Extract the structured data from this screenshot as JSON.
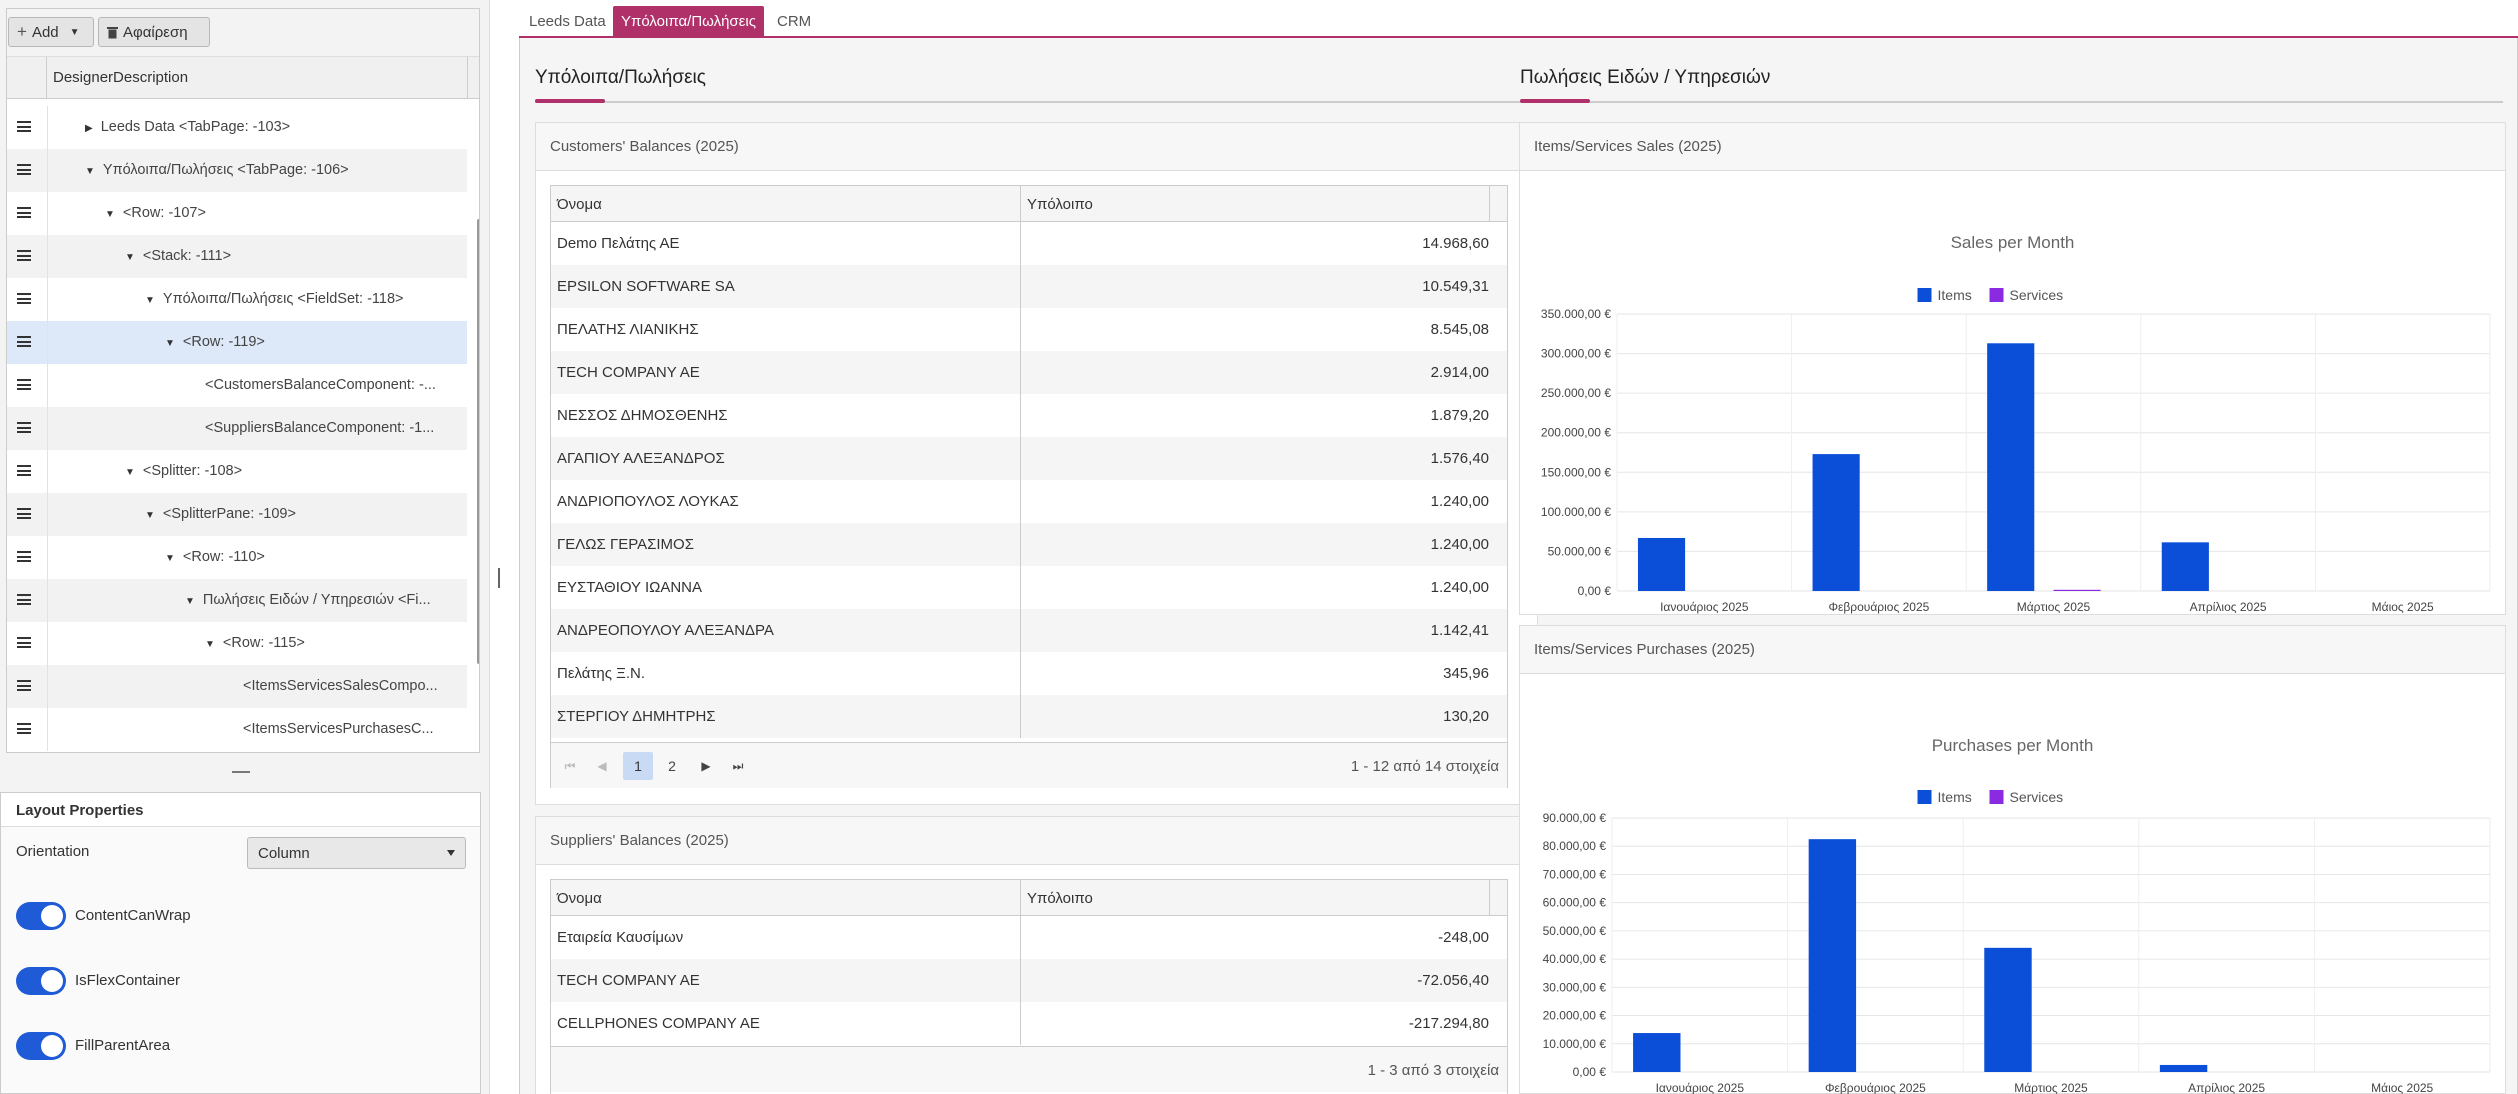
{
  "left_panel": {
    "toolbar": {
      "add_label": "Add",
      "remove_label": "Αφαίρεση"
    },
    "tree": {
      "column_header": "DesignerDescription",
      "rows": [
        {
          "label": "Leeds Data <TabPage: -103>",
          "expanded": false
        },
        {
          "label": "Υπόλοιπα/Πωλήσεις <TabPage: -106>",
          "expanded": true
        },
        {
          "label": "<Row: -107>",
          "expanded": true
        },
        {
          "label": "<Stack: -111>",
          "expanded": true
        },
        {
          "label": "Υπόλοιπα/Πωλήσεις <FieldSet: -118>",
          "expanded": true
        },
        {
          "label": "<Row: -119>",
          "expanded": true,
          "selected": true
        },
        {
          "label": "<CustomersBalanceComponent: -..."
        },
        {
          "label": "<SuppliersBalanceComponent: -1..."
        },
        {
          "label": "<Splitter: -108>",
          "expanded": true
        },
        {
          "label": "<SplitterPane: -109>",
          "expanded": true
        },
        {
          "label": "<Row: -110>",
          "expanded": true
        },
        {
          "label": "Πωλήσεις Ειδών / Υπηρεσιών <Fi...",
          "expanded": true
        },
        {
          "label": "<Row: -115>",
          "expanded": true
        },
        {
          "label": "<ItemsServicesSalesCompo..."
        },
        {
          "label": "<ItemsServicesPurchasesC..."
        }
      ]
    },
    "layout_properties": {
      "title": "Layout Properties",
      "orientation_label": "Orientation",
      "orientation_value": "Column",
      "toggles": [
        {
          "label": "ContentCanWrap",
          "on": true
        },
        {
          "label": "IsFlexContainer",
          "on": true
        },
        {
          "label": "FillParentArea",
          "on": true
        }
      ]
    }
  },
  "tabs": [
    {
      "label": "Leeds Data",
      "active": false
    },
    {
      "label": "Υπόλοιπα/Πωλήσεις",
      "active": true
    },
    {
      "label": "CRM",
      "active": false
    }
  ],
  "balances_section": {
    "title": "Υπόλοιπα/Πωλήσεις",
    "customers": {
      "title": "Customers' Balances (2025)",
      "col_name": "Όνομα",
      "col_balance": "Υπόλοιπο",
      "rows": [
        {
          "name": "Demo Πελάτης ΑΕ",
          "balance": "14.968,60"
        },
        {
          "name": "EPSILON SOFTWARE SA",
          "balance": "10.549,31"
        },
        {
          "name": "ΠΕΛΑΤΗΣ ΛΙΑΝΙΚΗΣ",
          "balance": "8.545,08"
        },
        {
          "name": "TECH COMPANY AE",
          "balance": "2.914,00"
        },
        {
          "name": "ΝΕΣΣΟΣ ΔΗΜΟΣΘΕΝΗΣ",
          "balance": "1.879,20"
        },
        {
          "name": "ΑΓΑΠΙΟΥ ΑΛΕΞΑΝΔΡΟΣ",
          "balance": "1.576,40"
        },
        {
          "name": "ΑΝΔΡΙΟΠΟΥΛΟΣ ΛΟΥΚΑΣ",
          "balance": "1.240,00"
        },
        {
          "name": "ΓΕΛΩΣ ΓΕΡΑΣΙΜΟΣ",
          "balance": "1.240,00"
        },
        {
          "name": "ΕΥΣΤΑΘΙΟΥ ΙΩΑΝΝΑ",
          "balance": "1.240,00"
        },
        {
          "name": "ΑΝΔΡΕΟΠΟΥΛΟΥ ΑΛΕΞΑΝΔΡΑ",
          "balance": "1.142,41"
        },
        {
          "name": "Πελάτης Ξ.Ν.",
          "balance": "345,96"
        },
        {
          "name": "ΣΤΕΡΓΙΟΥ ΔΗΜΗΤΡΗΣ",
          "balance": "130,20"
        }
      ],
      "pager": {
        "current_page": "1",
        "other_page": "2",
        "info": "1 - 12 από 14 στοιχεία"
      }
    },
    "suppliers": {
      "title": "Suppliers' Balances (2025)",
      "col_name": "Όνομα",
      "col_balance": "Υπόλοιπο",
      "rows": [
        {
          "name": "Εταιρεία Καυσίμων",
          "balance": "-248,00"
        },
        {
          "name": "TECH COMPANY AE",
          "balance": "-72.056,40"
        },
        {
          "name": "CELLPHONES COMPANY AE",
          "balance": "-217.294,80"
        }
      ],
      "pager": {
        "info": "1 - 3 από 3 στοιχεία"
      }
    }
  },
  "sales_section": {
    "title": "Πωλήσεις Ειδών / Υπηρεσιών",
    "sales_panel_title": "Items/Services Sales (2025)",
    "purchases_panel_title": "Items/Services Purchases (2025)"
  },
  "colors": {
    "accent": "#b0306a",
    "items": "#0b4fd8",
    "services": "#8a2be2",
    "toggle": "#1f5bd6"
  },
  "chart_data": [
    {
      "type": "bar",
      "title": "Sales per Month",
      "categories": [
        "Ιανουάριος 2025",
        "Φεβρουάριος 2025",
        "Μάρτιος 2025",
        "Απρίλιος 2025",
        "Μάιος 2025"
      ],
      "series": [
        {
          "name": "Items",
          "values": [
            67000,
            173000,
            313000,
            61500,
            0
          ]
        },
        {
          "name": "Services",
          "values": [
            0,
            0,
            1500,
            0,
            0
          ]
        }
      ],
      "ylim": [
        0,
        350000
      ],
      "yticks": [
        "0,00 €",
        "50.000,00 €",
        "100.000,00 €",
        "150.000,00 €",
        "200.000,00 €",
        "250.000,00 €",
        "300.000,00 €",
        "350.000,00 €"
      ],
      "legend": "top"
    },
    {
      "type": "bar",
      "title": "Purchases per Month",
      "categories": [
        "Ιανουάριος 2025",
        "Φεβρουάριος 2025",
        "Μάρτιος 2025",
        "Απρίλιος 2025",
        "Μάιος 2025"
      ],
      "series": [
        {
          "name": "Items",
          "values": [
            13800,
            82500,
            44000,
            2500,
            0
          ]
        },
        {
          "name": "Services",
          "values": [
            0,
            0,
            0,
            0,
            0
          ]
        }
      ],
      "ylim": [
        0,
        90000
      ],
      "yticks": [
        "0,00 €",
        "10.000,00 €",
        "20.000,00 €",
        "30.000,00 €",
        "40.000,00 €",
        "50.000,00 €",
        "60.000,00 €",
        "70.000,00 €",
        "80.000,00 €",
        "90.000,00 €"
      ],
      "legend": "top"
    }
  ]
}
